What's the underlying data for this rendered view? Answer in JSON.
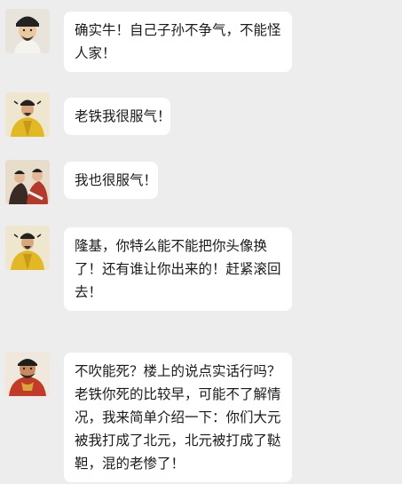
{
  "chat": {
    "messages": [
      {
        "sender": "scholar-avatar",
        "text": "确实牛！自己子孙不争气，不能怪人家！"
      },
      {
        "sender": "yellow-robe-avatar",
        "text": "老铁我很服气！"
      },
      {
        "sender": "painting-avatar",
        "text": "我也很服气！"
      },
      {
        "sender": "yellow-robe-avatar",
        "text": "隆基，你特么能不能把你头像换了！还有谁让你出来的！赶紧滚回去！"
      },
      {
        "sender": "red-robe-avatar",
        "text": "不吹能死？楼上的说点实话行吗？老铁你死的比较早，可能不了解情况，我来简单介绍一下：你们大元被我打成了北元，北元被打成了鞑靼，混的老惨了！"
      }
    ]
  },
  "colors": {
    "background": "#ededed",
    "bubble": "#ffffff",
    "text": "#1a1a1a"
  }
}
